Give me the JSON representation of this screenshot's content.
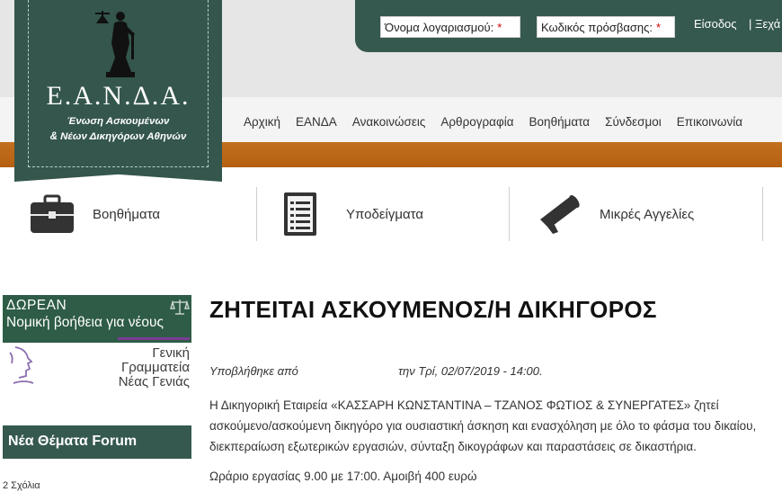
{
  "login": {
    "username_placeholder": "Όνομα λογαριασμού:",
    "password_placeholder": "Κωδικός πρόσβασης:",
    "required_mark": "*",
    "login_label": "Είσοδος",
    "forgot_label": "| Ξεχά"
  },
  "logo": {
    "acronym": "Ε.Α.Ν.Δ.Α.",
    "subtitle_line1": "Ένωση Ασκουμένων",
    "subtitle_line2": "& Νέων Δικηγόρων Αθηνών"
  },
  "nav": {
    "items": [
      "Αρχική",
      "ΕΑΝΔΑ",
      "Ανακοινώσεις",
      "Αρθρογραφία",
      "Βοηθήματα",
      "Σύνδεσμοι",
      "Επικοινωνία"
    ]
  },
  "features": [
    {
      "label": "Βοηθήματα",
      "icon": "briefcase-icon"
    },
    {
      "label": "Υποδείγματα",
      "icon": "document-icon"
    },
    {
      "label": "Μικρές Αγγελίες",
      "icon": "megaphone-icon"
    }
  ],
  "sidebar": {
    "promo_line1": "ΔΩΡΕΑΝ",
    "promo_line2": "Νομική βοήθεια για νέους",
    "promo_org1": "Γενική",
    "promo_org2": "Γραμματεία",
    "promo_org3": "Νέας Γενιάς",
    "forum_title": "Νέα Θέματα Forum",
    "comments": "2 Σχόλια"
  },
  "article": {
    "title": "ΖΗΤΕΙΤΑΙ ΑΣΚΟΥΜΕΝΟΣ/Η ΔΙΚΗΓΟΡΟΣ",
    "submitted_prefix": "Υποβλήθηκε από",
    "submitted_suffix": "την Τρί, 02/07/2019 - 14:00.",
    "body": "Η Δικηγορική Εταιρεία «ΚΑΣΣΑΡΗ ΚΩΝΣΤΑΝΤΙΝΑ – ΤΖΑΝΟΣ ΦΩΤΙΟΣ & ΣΥΝΕΡΓΑΤΕΣ» ζητεί ασκούμενο/ασκούμενη δικηγόρο για ουσιαστική άσκηση και ενασχόληση με όλο το φάσμα του δικαίου, διεκπεραίωση εξωτερικών εργασιών, σύνταξη δικογράφων και παραστάσεις σε δικαστήρια.",
    "hours": "Ωράριο εργασίας 9.00 με 17:00. Αμοιβή 400 ευρώ"
  },
  "colors": {
    "brand_green": "#35594f",
    "accent_orange": "#b8621a",
    "promo_green": "#2e5c46",
    "promo_purple": "#7a3d96"
  }
}
